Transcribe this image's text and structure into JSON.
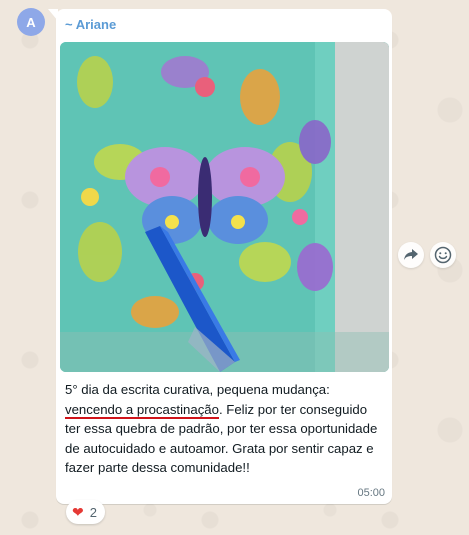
{
  "avatar": {
    "initial": "A",
    "color": "#8ea8e8"
  },
  "message": {
    "sender": "~ Ariane",
    "sender_color": "#5b9bd5",
    "caption_part1": "5° dia da escrita curativa,  pequena mudança: ",
    "caption_underlined": "vencendo a procastinação",
    "caption_part2": ". Feliz por ter conseguido ter essa quebra de padrão, por ter essa oportunidade de autocuidado e autoamor. Grata por sentir capaz e fazer parte dessa comunidade!!",
    "time": "05:00",
    "image_alt": "notebook with butterfly pattern and blue pen"
  },
  "reaction": {
    "emoji": "❤",
    "count": "2"
  },
  "actions": {
    "forward_icon": "forward-icon",
    "emoji_icon": "emoji-icon"
  },
  "colors": {
    "underline": "#d0131a",
    "photo_bg": "#5fc4b5"
  }
}
